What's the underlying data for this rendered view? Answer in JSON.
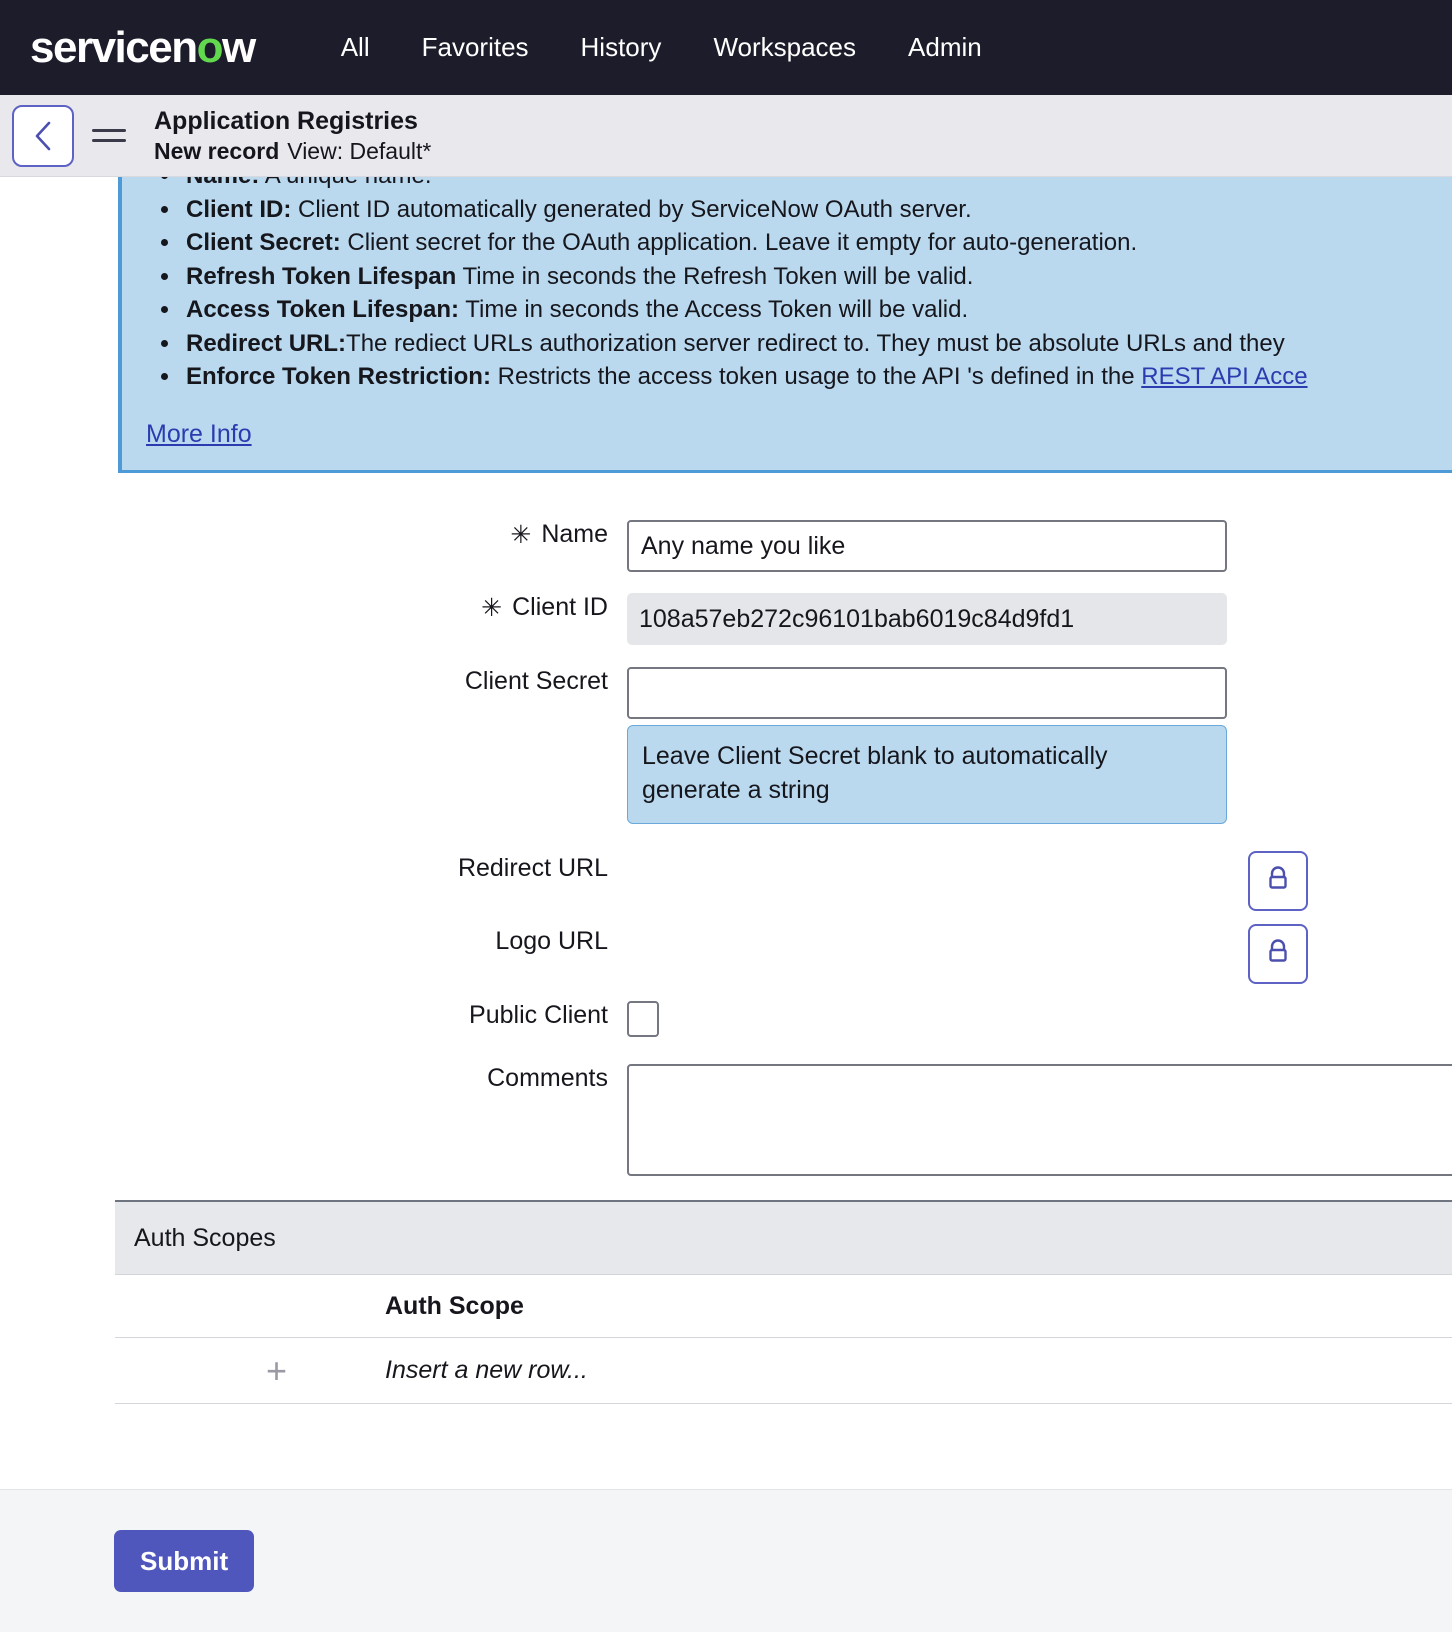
{
  "topnav": {
    "logo": {
      "part1": "servicen",
      "part2": "o",
      "part3": "w"
    },
    "items": [
      {
        "label": "All"
      },
      {
        "label": "Favorites"
      },
      {
        "label": "History"
      },
      {
        "label": "Workspaces"
      },
      {
        "label": "Admin"
      }
    ]
  },
  "breadcrumb": {
    "back_icon": "chevron-left-icon",
    "menu_icon": "hamburger-icon",
    "title": "Application Registries",
    "record_state": "New record",
    "view": "View: Default*"
  },
  "info_banner": {
    "bullets": [
      {
        "term": "Name:",
        "text": " A unique name."
      },
      {
        "term": "Client ID:",
        "text": " Client ID automatically generated by ServiceNow OAuth server."
      },
      {
        "term": "Client Secret:",
        "text": " Client secret for the OAuth application. Leave it empty for auto-generation."
      },
      {
        "term": "Refresh Token Lifespan",
        "text": " Time in seconds the Refresh Token will be valid."
      },
      {
        "term": "Access Token Lifespan:",
        "text": " Time in seconds the Access Token will be valid."
      },
      {
        "term": "Redirect URL:",
        "text": "The rediect URLs authorization server redirect to. They must be absolute URLs and they"
      },
      {
        "term": "Enforce Token Restriction:",
        "text": " Restricts the access token usage to the API 's defined in the ",
        "link": "REST API Acce"
      }
    ],
    "more_info_label": "More Info"
  },
  "form": {
    "required_marker": "✳",
    "name": {
      "label": "Name",
      "value": "Any name you like",
      "placeholder": ""
    },
    "client_id": {
      "label": "Client ID",
      "value": "108a57eb272c96101bab6019c84d9fd1"
    },
    "client_secret": {
      "label": "Client Secret",
      "value": "",
      "placeholder": "",
      "hint": "Leave Client Secret blank to automatically generate a string"
    },
    "redirect_url": {
      "label": "Redirect URL",
      "value": "",
      "lock_icon": "lock-icon"
    },
    "logo_url": {
      "label": "Logo URL",
      "value": "",
      "lock_icon": "lock-icon"
    },
    "public_client": {
      "label": "Public Client",
      "checked": false
    },
    "comments": {
      "label": "Comments",
      "value": ""
    }
  },
  "auth_scopes": {
    "section_title": "Auth Scopes",
    "column_header": "Auth Scope",
    "insert_row_label": "Insert a new row...",
    "add_icon": "plus-icon"
  },
  "footer": {
    "submit_label": "Submit"
  },
  "colors": {
    "nav_bg": "#1c1c2b",
    "logo_green": "#62d84e",
    "accent_purple": "#4f57bd",
    "banner_blue": "#bad9ef",
    "banner_border": "#4d9ad6",
    "link_blue": "#2b3cb0"
  }
}
